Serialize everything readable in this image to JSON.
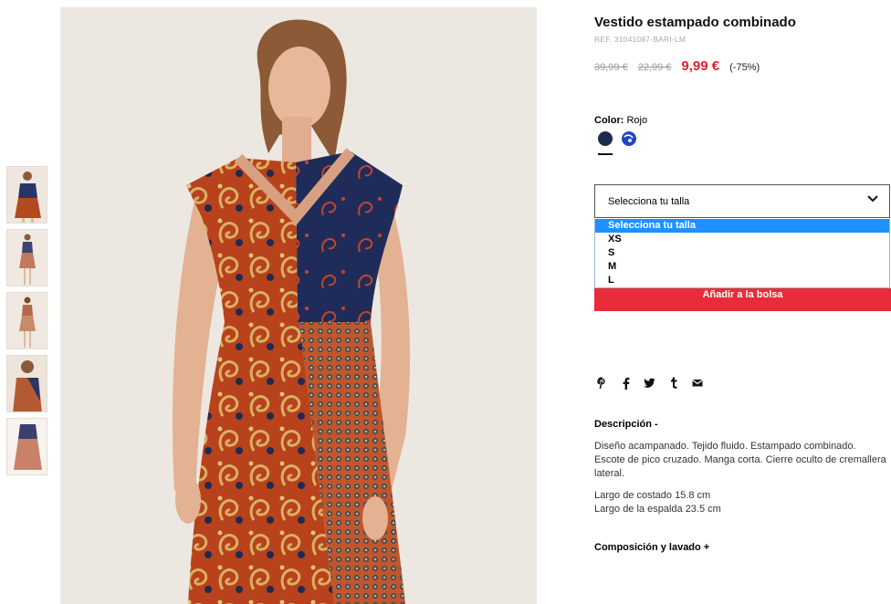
{
  "product": {
    "title": "Vestido estampado combinado",
    "ref": "REF. 31041087-BARI-LM",
    "price_original": "39,99 €",
    "price_previous": "22,99 €",
    "price_sale": "9,99 €",
    "discount": "(-75%)"
  },
  "color": {
    "label": "Color:",
    "value": "Rojo",
    "swatches": [
      {
        "name": "navy",
        "color": "#1c2a4d"
      },
      {
        "name": "blue-print",
        "color": "#2246c2"
      }
    ]
  },
  "size": {
    "placeholder": "Selecciona tu talla",
    "options": [
      "Selecciona tu talla",
      "XS",
      "S",
      "M",
      "L"
    ],
    "highlighted_index": 0
  },
  "add_to_bag": "Añadir a la bolsa",
  "share": {
    "icons": [
      "pinterest-icon",
      "facebook-icon",
      "twitter-icon",
      "tumblr-icon",
      "email-icon"
    ]
  },
  "description": {
    "heading": "Descripción -",
    "paragraph1": "Diseño acampanado. Tejido fluido. Estampado combinado. Escote de pico cruzado. Manga corta. Cierre oculto de cremallera lateral.",
    "line1": "Largo de costado 15.8 cm",
    "line2": "Largo de la espalda 23.5 cm"
  },
  "composition": {
    "heading": "Composición y lavado +"
  },
  "colors": {
    "sale_red": "#e0202f",
    "button_red": "#e72d3a",
    "dropdown_highlight": "#1e90ff",
    "image_background": "#ece7e1"
  }
}
